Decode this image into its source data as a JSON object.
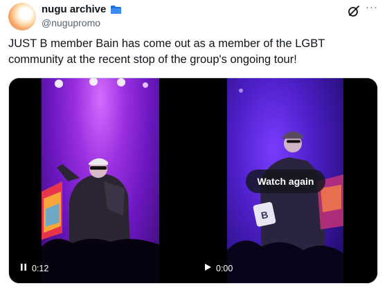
{
  "author": {
    "display_name": "nugu archive",
    "handle": "@nugupromo",
    "badge_icon": "folder-icon",
    "avatar_color": "#f08a48"
  },
  "actions": {
    "grok_icon": "grok-icon",
    "more_label": "···"
  },
  "tweet": {
    "text": "JUST B member Bain has come out as a member of the LGBT community at the recent stop of the group's ongoing tour!"
  },
  "media": {
    "left_video": {
      "state_icon": "pause-icon",
      "time": "0:12"
    },
    "right_video": {
      "state_icon": "play-icon",
      "time": "0:00",
      "overlay_button": "Watch again"
    }
  },
  "colors": {
    "text_primary": "#0f1419",
    "text_secondary": "#536471",
    "stage_purple": "#9a2fe0"
  }
}
